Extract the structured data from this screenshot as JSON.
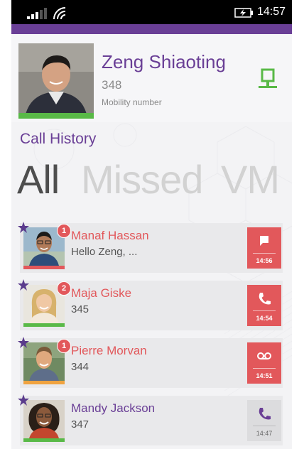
{
  "status_bar": {
    "time": "14:57"
  },
  "contact": {
    "name": "Zeng Shiaoting",
    "extension": "348",
    "number_type": "Mobility number",
    "presence_color": "#59b947"
  },
  "history": {
    "title": "Call History",
    "tabs": [
      "All",
      "Missed",
      "VM"
    ],
    "active_tab": "All",
    "items": [
      {
        "name": "Manaf Hassan",
        "detail": "Hello Zeng, ...",
        "badge": "1",
        "type_icon": "message-icon",
        "time": "14:56",
        "missed": true,
        "presence_color": "#e2585b"
      },
      {
        "name": "Maja Giske",
        "detail": "345",
        "badge": "2",
        "type_icon": "phone-icon",
        "time": "14:54",
        "missed": true,
        "presence_color": "#59b947"
      },
      {
        "name": "Pierre Morvan",
        "detail": "344",
        "badge": "1",
        "type_icon": "voicemail-icon",
        "time": "14:51",
        "missed": true,
        "presence_color": "#f0a340"
      },
      {
        "name": "Mandy Jackson",
        "detail": "347",
        "type_icon": "phone-icon",
        "time": "14:47",
        "missed": false,
        "presence_color": "#59b947"
      }
    ]
  },
  "colors": {
    "accent": "#6a3f96",
    "missed": "#e2585b",
    "available": "#59b947",
    "busy": "#f0a340"
  }
}
